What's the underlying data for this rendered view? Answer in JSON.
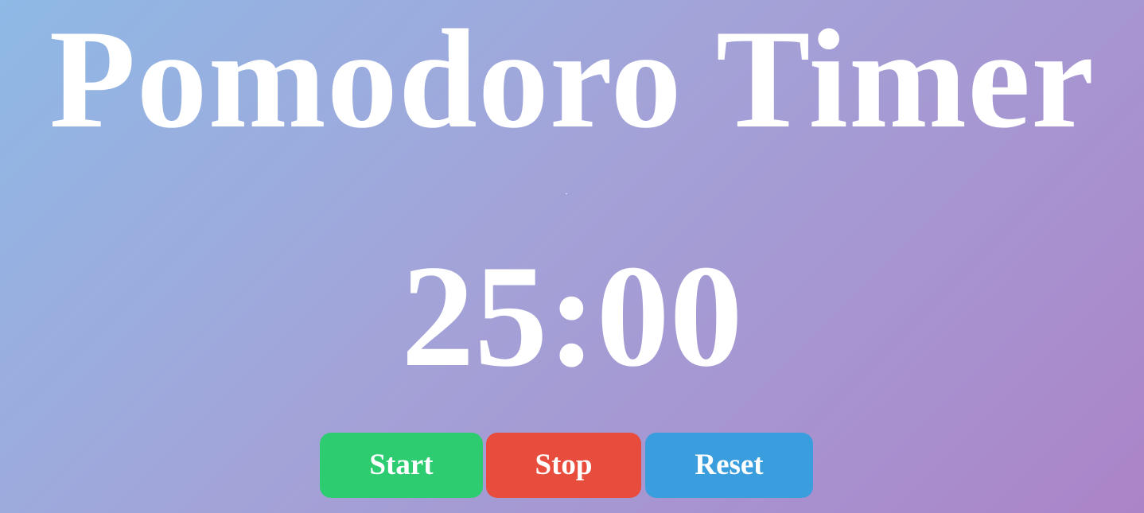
{
  "app": {
    "title": "Pomodoro Timer"
  },
  "timer": {
    "display": "25:00"
  },
  "controls": {
    "start_label": "Start",
    "stop_label": "Stop",
    "reset_label": "Reset"
  },
  "colors": {
    "background_start": "#8fb9e6",
    "background_end": "#ab84c8",
    "start": "#2ecc71",
    "stop": "#e74c3c",
    "reset": "#3a9ddd",
    "text": "#ffffff"
  }
}
